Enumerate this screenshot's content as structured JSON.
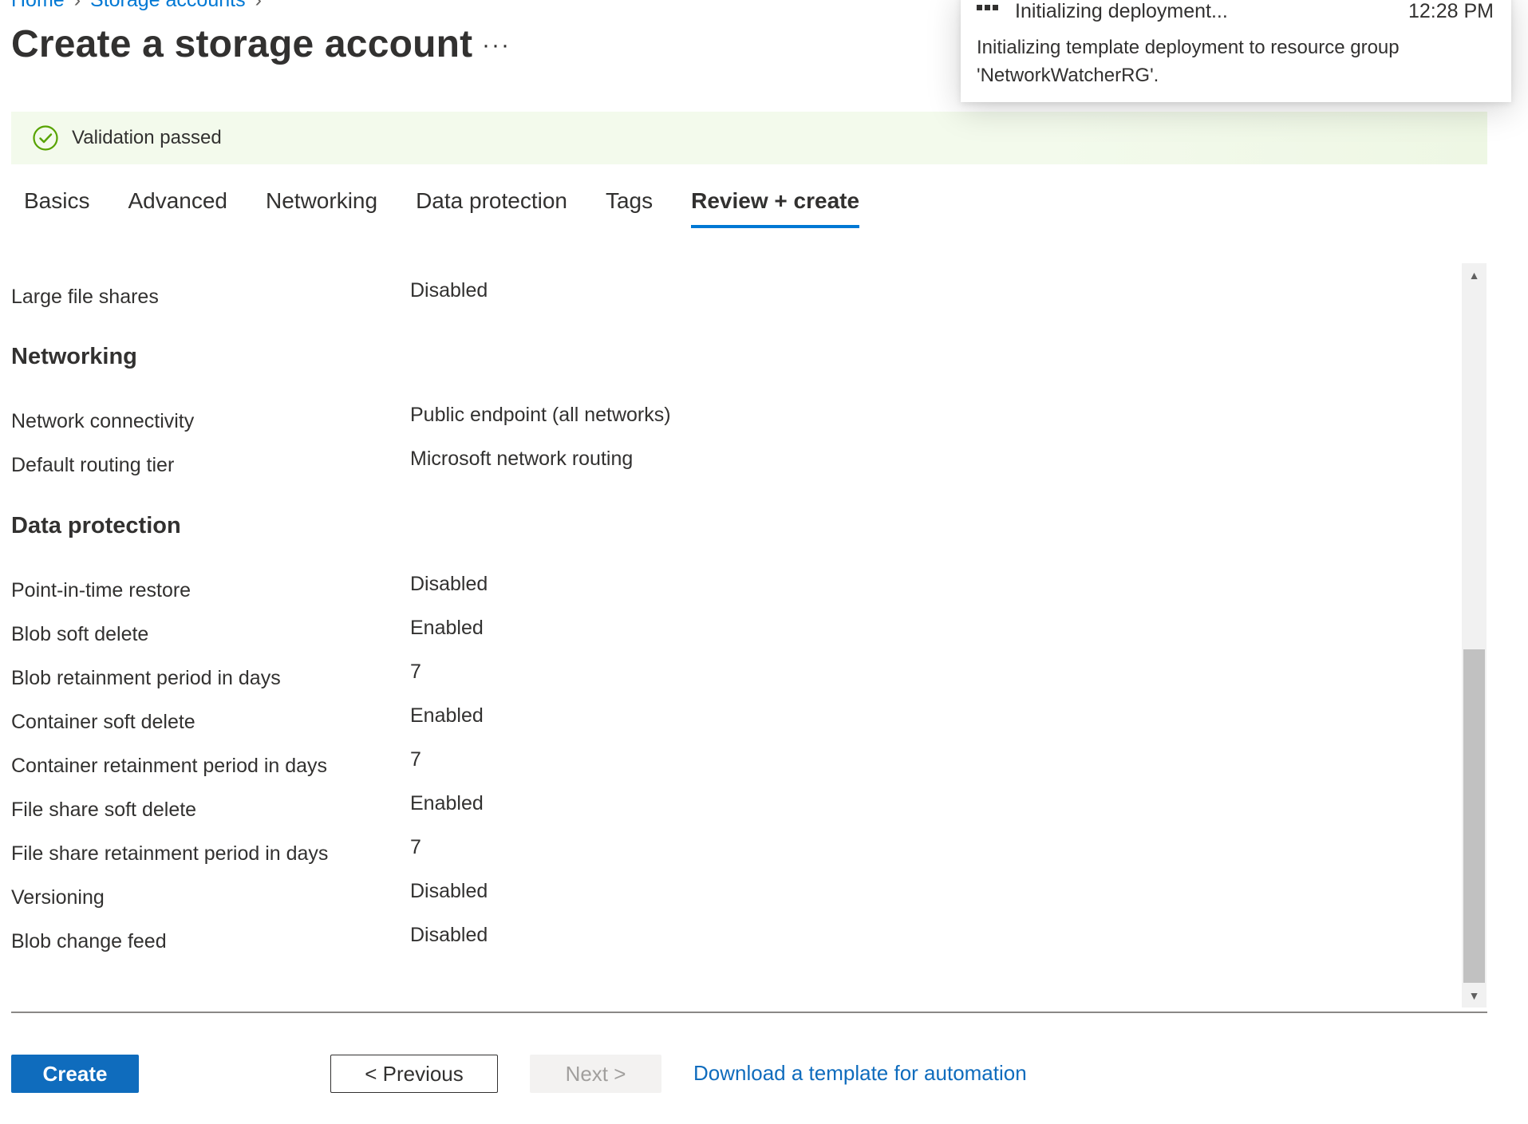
{
  "breadcrumb": {
    "items": [
      "Home",
      "Storage accounts"
    ]
  },
  "page": {
    "title": "Create a storage account",
    "more_label": "···"
  },
  "validation": {
    "text": "Validation passed",
    "color": "#57a300"
  },
  "tabs": [
    {
      "label": "Basics"
    },
    {
      "label": "Advanced"
    },
    {
      "label": "Networking"
    },
    {
      "label": "Data protection"
    },
    {
      "label": "Tags"
    },
    {
      "label": "Review + create",
      "active": true
    }
  ],
  "review": {
    "large_file_shares": {
      "label": "Large file shares",
      "value": "Disabled"
    },
    "networking": {
      "heading": "Networking",
      "network_connectivity": {
        "label": "Network connectivity",
        "value": "Public endpoint (all networks)"
      },
      "default_routing_tier": {
        "label": "Default routing tier",
        "value": "Microsoft network routing"
      }
    },
    "data_protection": {
      "heading": "Data protection",
      "rows": [
        {
          "label": "Point-in-time restore",
          "value": "Disabled"
        },
        {
          "label": "Blob soft delete",
          "value": "Enabled"
        },
        {
          "label": "Blob retainment period in days",
          "value": "7"
        },
        {
          "label": "Container soft delete",
          "value": "Enabled"
        },
        {
          "label": "Container retainment period in days",
          "value": "7"
        },
        {
          "label": "File share soft delete",
          "value": "Enabled"
        },
        {
          "label": "File share retainment period in days",
          "value": "7"
        },
        {
          "label": "Versioning",
          "value": "Disabled"
        },
        {
          "label": "Blob change feed",
          "value": "Disabled"
        }
      ]
    }
  },
  "footer": {
    "create_label": "Create",
    "previous_label": "< Previous",
    "next_label": "Next >",
    "download_label": "Download a template for automation"
  },
  "notification": {
    "title": "Initializing deployment...",
    "time": "12:28 PM",
    "message": "Initializing template deployment to resource group 'NetworkWatcherRG'."
  },
  "colors": {
    "accent": "#0f6cbd",
    "validation_bg": "#f3faec"
  }
}
